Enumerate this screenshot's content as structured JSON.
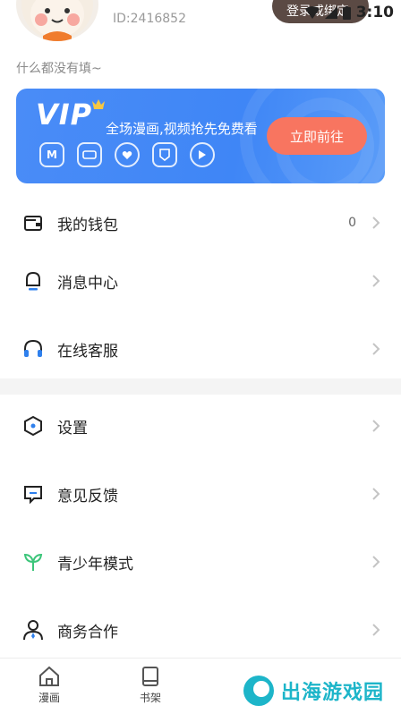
{
  "profile": {
    "user_id": "ID:2416852",
    "login_button": "登录或绑定",
    "signature": "什么都没有填~"
  },
  "status_bar": {
    "time": "3:10"
  },
  "vip_banner": {
    "logo": "VIP",
    "slogan": "全场漫画,视频抢先免费看",
    "cta_label": "立即前往",
    "perk_icons": [
      "comic-icon",
      "video-ad-icon",
      "heart-icon",
      "badge-icon",
      "play-icon"
    ]
  },
  "menu": {
    "wallet": {
      "label": "我的钱包",
      "count": "0",
      "icon": "wallet-icon"
    },
    "messages": {
      "label": "消息中心",
      "icon": "bell-icon"
    },
    "support": {
      "label": "在线客服",
      "icon": "headset-icon"
    },
    "settings": {
      "label": "设置",
      "icon": "hexagon-settings-icon"
    },
    "feedback": {
      "label": "意见反馈",
      "icon": "feedback-icon"
    },
    "teen_mode": {
      "label": "青少年模式",
      "icon": "sprout-icon"
    },
    "business": {
      "label": "商务合作",
      "icon": "person-tie-icon"
    }
  },
  "bottom_nav": {
    "items": [
      {
        "label": "漫画",
        "icon": "house-icon"
      },
      {
        "label": "书架",
        "icon": "book-icon"
      }
    ]
  },
  "watermark": {
    "text": "出海游戏园"
  },
  "colors": {
    "vip_blue": "#4a8cf7",
    "cta_coral": "#f87560",
    "teen_green": "#3cc57a",
    "support_blue": "#2f80ed"
  }
}
